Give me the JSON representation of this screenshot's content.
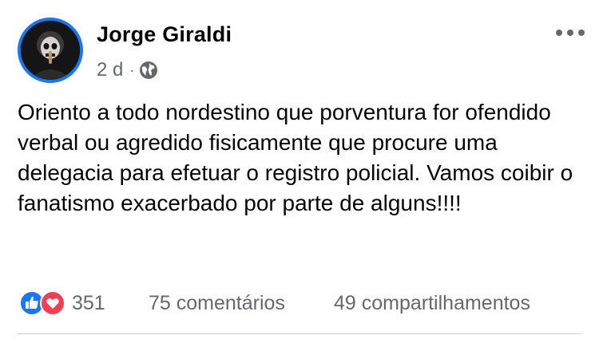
{
  "post": {
    "author": "Jorge Giraldi",
    "time": "2 d",
    "separator": "·",
    "audience_icon": "globe-icon",
    "text": "Oriento a todo nordestino que porventura for ofendido  verbal ou agredido fisicamente que procure uma delegacia para efetuar o registro policial. Vamos coibir o fanatismo exacerbado por parte de alguns!!!!"
  },
  "footer": {
    "reactions": [
      "like-icon",
      "love-icon"
    ],
    "reaction_count": "351",
    "comments": "75 comentários",
    "shares": "49 compartilhamentos"
  },
  "colors": {
    "brand": "#1877f2",
    "secondary_text": "#65676b",
    "love": "#f33e58"
  }
}
